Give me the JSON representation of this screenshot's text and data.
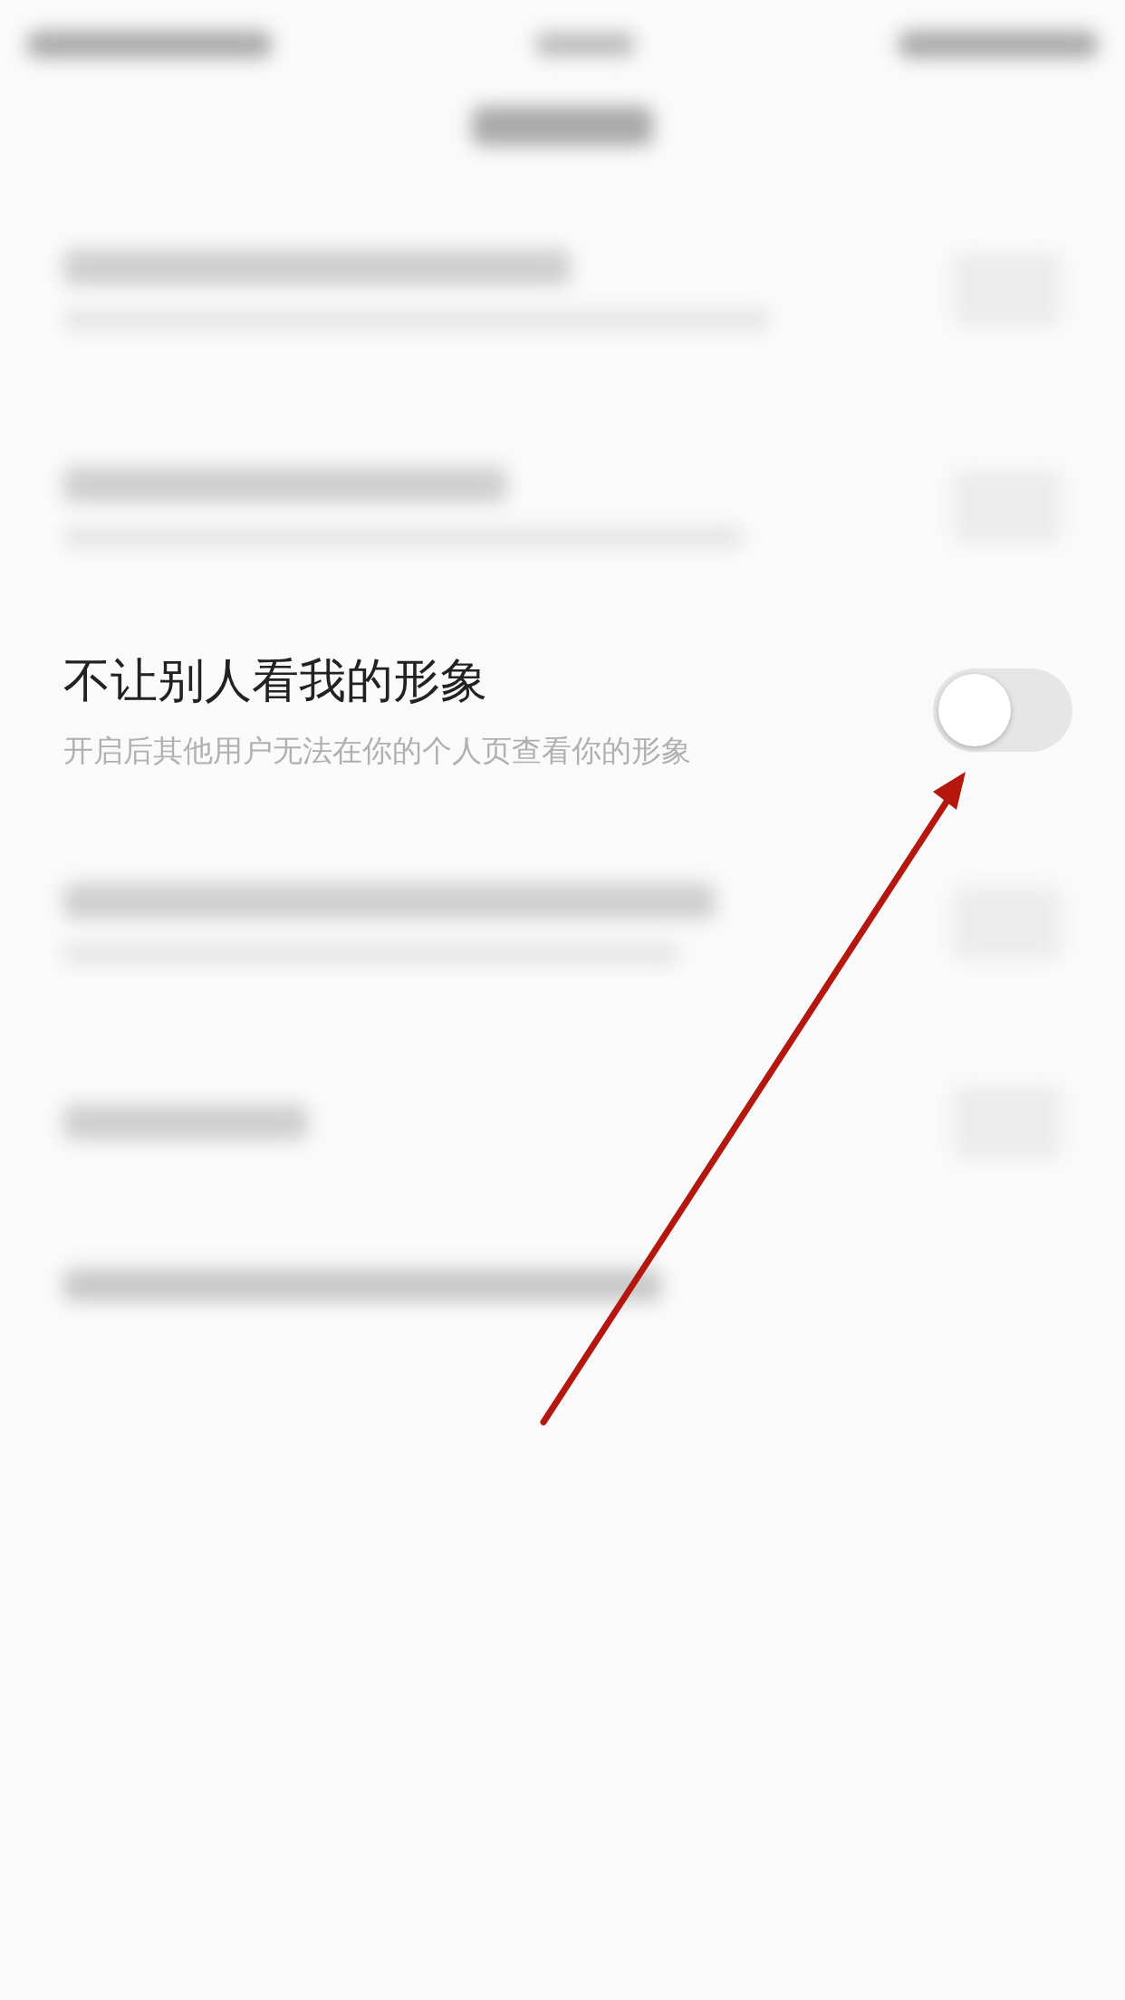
{
  "setting": {
    "title": "不让别人看我的形象",
    "description": "开启后其他用户无法在你的个人页查看你的形象",
    "on": false
  }
}
